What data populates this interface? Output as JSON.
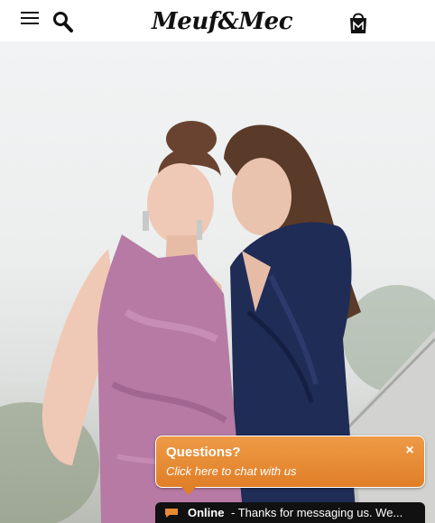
{
  "header": {
    "menu_icon": "hamburger-menu-icon",
    "search_icon": "search-icon",
    "logo_text": "Meuf&Mec",
    "bag_icon": "shopping-bag-icon"
  },
  "hero": {
    "image_subject": "two models in velvet dresses, pink and navy"
  },
  "chat": {
    "title": "Questions?",
    "subtitle": "Click here to chat with us",
    "close_label": "×",
    "status": "Online",
    "message": " - Thanks for messaging us. We..."
  },
  "colors": {
    "chat_orange": "#e78a33",
    "chat_bar": "#111111",
    "pink_dress": "#b77aa4",
    "navy_dress": "#1f2c56"
  }
}
